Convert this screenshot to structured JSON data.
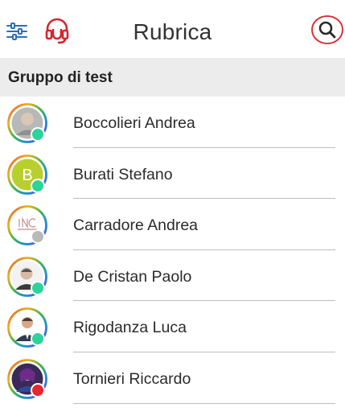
{
  "header": {
    "title": "Rubrica",
    "filter_icon": "sliders-icon",
    "support_icon": "headset-icon",
    "search_icon": "search-icon",
    "accent_color": "#d8232a"
  },
  "group": {
    "name": "Gruppo di test"
  },
  "contacts": [
    {
      "name": "Boccolieri Andrea",
      "avatar": "photo",
      "status": "available",
      "status_color": "#2ed39a"
    },
    {
      "name": "Burati Stefano",
      "avatar": "initial",
      "initial": "B",
      "status": "available",
      "status_color": "#2ed39a"
    },
    {
      "name": "Carradore Andrea",
      "avatar": "logo",
      "status": "offline",
      "status_color": "#b9b9b9"
    },
    {
      "name": "De Cristan Paolo",
      "avatar": "photo",
      "status": "available",
      "status_color": "#2ed39a"
    },
    {
      "name": "Rigodanza Luca",
      "avatar": "photo",
      "status": "available",
      "status_color": "#2ed39a"
    },
    {
      "name": "Tornieri Riccardo",
      "avatar": "photo",
      "status": "busy",
      "status_color": "#e8262d"
    }
  ]
}
